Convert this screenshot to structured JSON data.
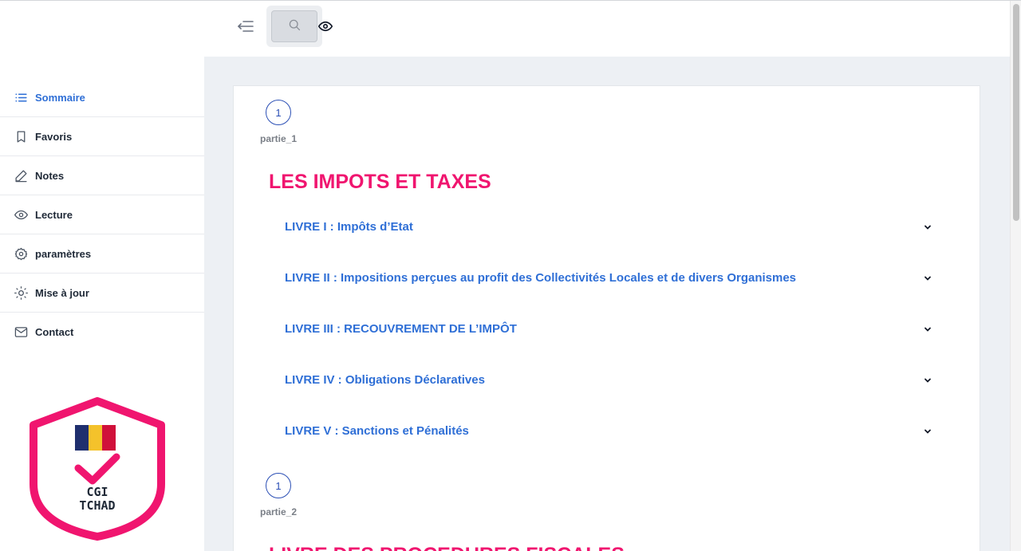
{
  "sidebar": {
    "items": [
      {
        "label": "Sommaire",
        "icon": "list-icon",
        "active": true
      },
      {
        "label": "Favoris",
        "icon": "bookmark-icon"
      },
      {
        "label": "Notes",
        "icon": "pencil-icon"
      },
      {
        "label": "Lecture",
        "icon": "eye-icon"
      },
      {
        "label": "paramètres",
        "icon": "gear-icon"
      },
      {
        "label": "Mise à jour",
        "icon": "sun-icon"
      },
      {
        "label": "Contact",
        "icon": "mail-icon"
      }
    ],
    "logo": {
      "line1": "CGI",
      "line2": "TCHAD",
      "colors": {
        "shield": "#f0156f",
        "flag": [
          "#1f2f6e",
          "#f4c22b",
          "#d0103a"
        ]
      }
    }
  },
  "topbar": {
    "menu_icon": "collapse-menu-icon",
    "search_icon": "search-icon",
    "view_icon": "eye-icon"
  },
  "content": {
    "parts": [
      {
        "number": "1",
        "label": "partie_1",
        "title": "LES IMPOTS ET TAXES",
        "livres": [
          "LIVRE I : Impôts d’Etat",
          "LIVRE II : Impositions perçues au profit des Collectivités Locales et de divers Organismes",
          "LIVRE III : RECOUVREMENT DE L’IMPÔT",
          "LIVRE IV : Obligations Déclaratives",
          "LIVRE V : Sanctions et Pénalités"
        ]
      },
      {
        "number": "1",
        "label": "partie_2",
        "title": "LIVRE DES PROCEDURES FISCALES"
      }
    ]
  },
  "colors": {
    "accent": "#2f6fd6",
    "title": "#f0156f",
    "background": "#edf0f4"
  }
}
